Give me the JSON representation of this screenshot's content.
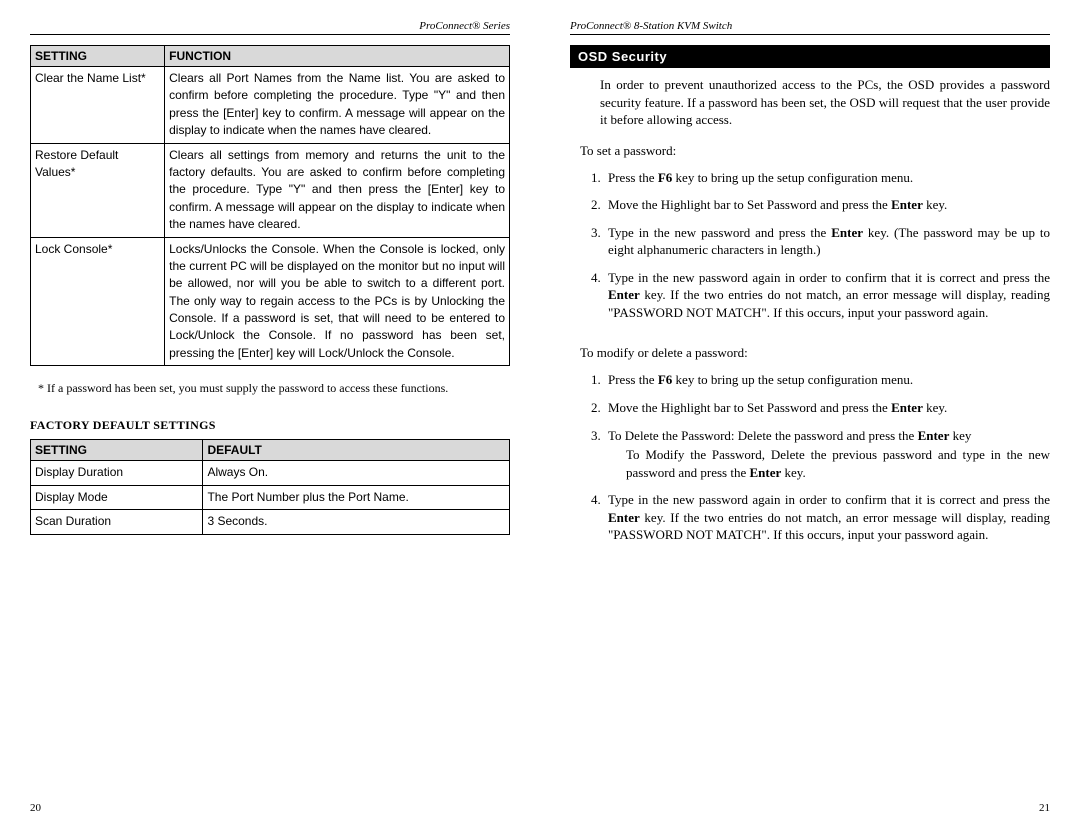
{
  "leftPage": {
    "header": "ProConnect® Series",
    "pageNumber": "20",
    "table1": {
      "headers": [
        "SETTING",
        "FUNCTION"
      ],
      "rows": [
        {
          "setting": "Clear the Name List*",
          "function": "Clears all Port Names from the Name list. You are asked to confirm before completing the procedure. Type \"Y\" and then press the [Enter] key to confirm. A message will appear on the display to indicate when the names have cleared."
        },
        {
          "setting": "Restore Default Values*",
          "function": "Clears all settings from memory and returns the unit to the factory defaults. You are asked to confirm before completing the procedure. Type \"Y\" and then press the [Enter] key to confirm. A message will appear on the display to indicate when the names have cleared."
        },
        {
          "setting": "Lock Console*",
          "function": "Locks/Unlocks the Console. When the Console is locked, only the current PC will be displayed on the monitor but no input will be allowed, nor will you be able to switch to a different port. The only way to regain access to the PCs is by Unlocking the Console. If a password is set, that will need to be entered to Lock/Unlock the Console. If no password has been set, pressing the [Enter] key will Lock/Unlock the Console."
        }
      ]
    },
    "footnote": "*   If a password has been set, you must supply the password to access these functions.",
    "subhead": "FACTORY DEFAULT SETTINGS",
    "table2": {
      "headers": [
        "SETTING",
        "DEFAULT"
      ],
      "rows": [
        {
          "setting": "Display Duration",
          "default": "Always On."
        },
        {
          "setting": "Display Mode",
          "default": "The Port Number plus the Port Name."
        },
        {
          "setting": "Scan Duration",
          "default": "3 Seconds."
        }
      ]
    }
  },
  "rightPage": {
    "header": "ProConnect® 8-Station KVM Switch",
    "pageNumber": "21",
    "sectionTitle": "OSD Security",
    "intro": "In order to prevent unauthorized access to the PCs, the OSD provides a password security feature. If a password has been set, the OSD will request that the user provide it before allowing access.",
    "set": {
      "lead": "To set a password:",
      "steps": [
        {
          "pre": "Press the ",
          "b1": "F6",
          "post": " key to bring up the setup configuration menu."
        },
        {
          "pre": "Move the Highlight bar to Set Password and press the ",
          "b1": "Enter",
          "post": " key."
        },
        {
          "pre": "Type in the new password and press the ",
          "b1": "Enter",
          "post": " key. (The password may be up to eight alphanumeric characters in length.)"
        },
        {
          "pre": "Type in the new password again in order to confirm that it is correct and press the ",
          "b1": "Enter",
          "post": " key. If the two entries do not match, an error message will display, reading \"PASSWORD NOT MATCH\". If this occurs, input your password again."
        }
      ]
    },
    "modify": {
      "lead": "To modify or delete a password:",
      "steps": [
        {
          "pre": "Press the ",
          "b1": "F6",
          "post": " key to bring up the setup configuration menu."
        },
        {
          "pre": "Move the Highlight bar to Set Password and press the ",
          "b1": "Enter",
          "post": " key."
        },
        {
          "pre": "To Delete the Password: Delete the password and press the ",
          "b1": "Enter",
          "post": " key",
          "sub_pre": "To Modify the Password, Delete the previous password and type in the new password and press the ",
          "sub_b": "Enter",
          "sub_post": " key."
        },
        {
          "pre": "Type in the new password again in order to confirm that it is correct and press the ",
          "b1": "Enter",
          "post": " key. If the two entries do not match, an error message will display, reading \"PASSWORD NOT MATCH\". If this occurs, input your password again."
        }
      ]
    }
  }
}
